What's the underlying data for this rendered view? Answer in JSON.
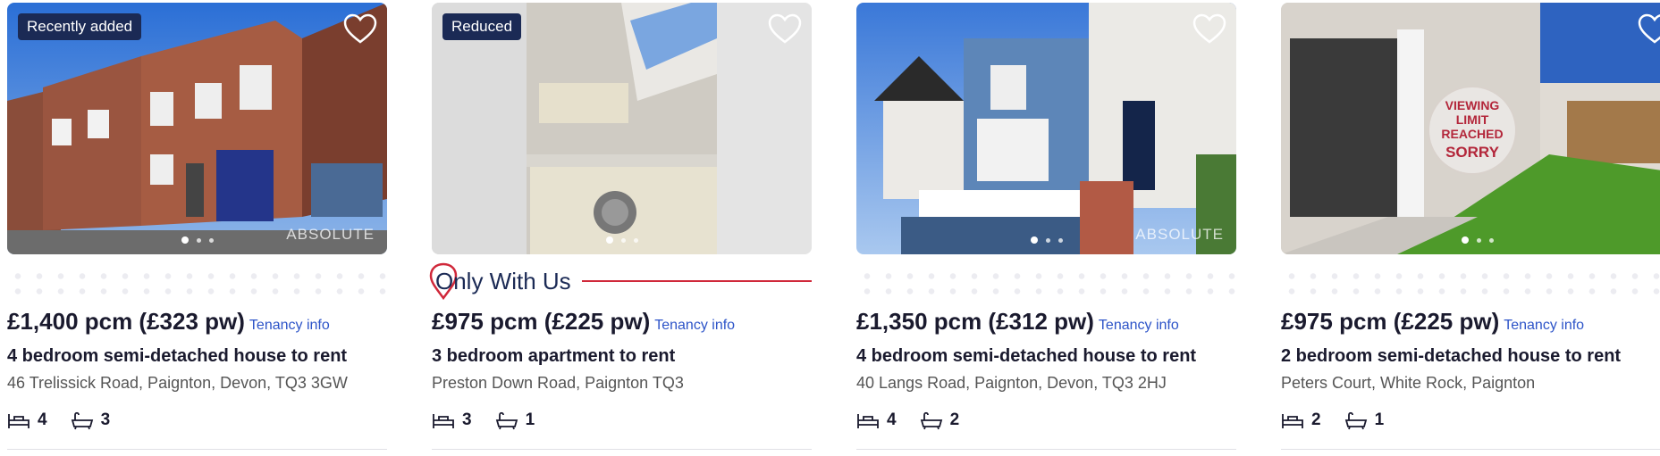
{
  "listings": [
    {
      "badge": "Recently added",
      "watermark": "ABSOLUTE",
      "price": "£1,400 pcm (£323 pw)",
      "tenancy_info": "Tenancy info",
      "title": "4 bedroom semi-detached house to rent",
      "address": "46 Trelissick Road, Paignton, Devon, TQ3 3GW",
      "bedrooms": "4",
      "bathrooms": "3"
    },
    {
      "badge": "Reduced",
      "promo": "Only With Us",
      "price": "£975 pcm (£225 pw)",
      "tenancy_info": "Tenancy info",
      "title": "3 bedroom apartment to rent",
      "address": "Preston Down Road, Paignton TQ3",
      "bedrooms": "3",
      "bathrooms": "1"
    },
    {
      "watermark": "ABSOLUTE",
      "price": "£1,350 pcm (£312 pw)",
      "tenancy_info": "Tenancy info",
      "title": "4 bedroom semi-detached house to rent",
      "address": "40 Langs Road, Paignton, Devon, TQ3 2HJ",
      "bedrooms": "4",
      "bathrooms": "2"
    },
    {
      "overlay_line1": "VIEWING",
      "overlay_line2": "LIMIT",
      "overlay_line3": "REACHED",
      "overlay_line4": "SORRY",
      "price": "£975 pcm (£225 pw)",
      "tenancy_info": "Tenancy info",
      "title": "2 bedroom semi-detached house to rent",
      "address": "Peters Court, White Rock, Paignton",
      "bedrooms": "2",
      "bathrooms": "1"
    }
  ],
  "icons": {
    "favourite": "heart-outline-icon",
    "bed": "bed-icon",
    "bath": "bath-icon",
    "pin": "map-pin-icon"
  },
  "colors": {
    "badge_bg": "#1b2a55",
    "link": "#2d54c8",
    "promo_red": "#d0283a",
    "promo_blue": "#1b2a55"
  }
}
